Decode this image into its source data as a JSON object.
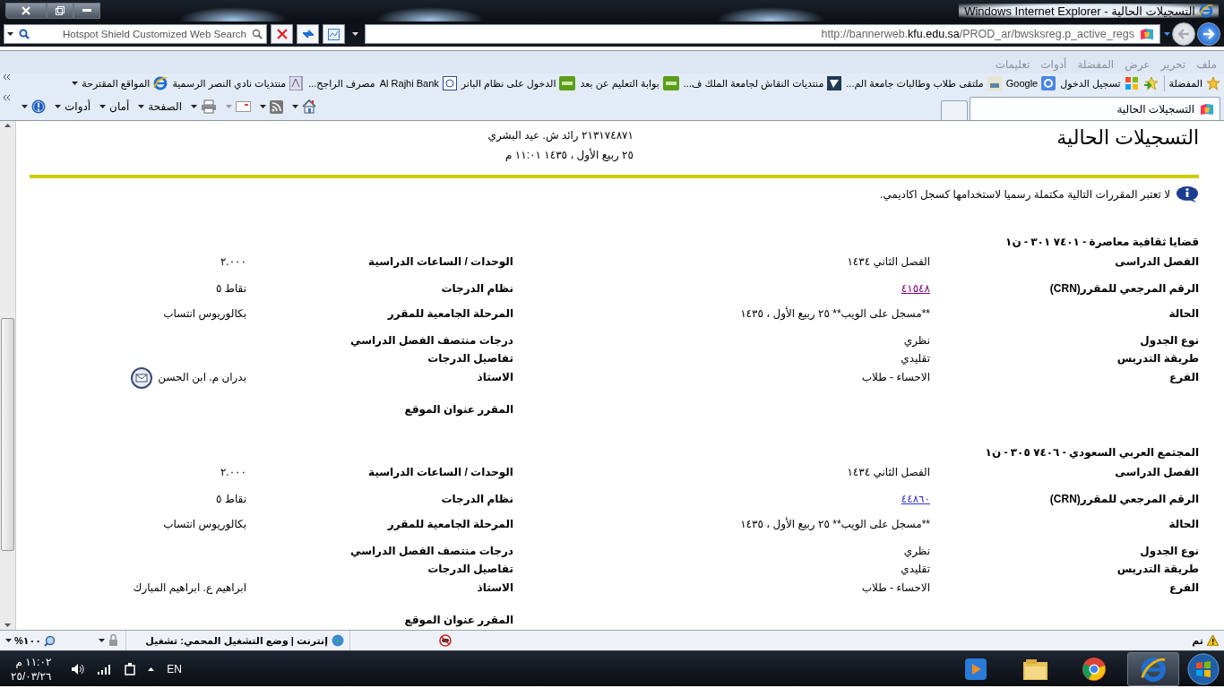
{
  "window": {
    "title": "التسجيلات الحالية - Windows Internet Explorer"
  },
  "address_bar": {
    "url": "http://bannerweb.**kfu.edu.sa**/PROD_ar/bwsksreg.p_active_regs"
  },
  "search": {
    "placeholder": "Hotspot Shield Customized Web Search"
  },
  "menu": [
    "ملف",
    "تحرير",
    "عرض",
    "المفضلة",
    "أدوات",
    "تعليمات"
  ],
  "favorites_bar": {
    "label": "المفضلة",
    "items": [
      {
        "label": "تسجيل الدخول"
      },
      {
        "label": "Google"
      },
      {
        "label": "ملتقى طلاب وطالبات جامعة الم..."
      },
      {
        "label": "منتديات النقاش لجامعة الملك ف..."
      },
      {
        "label": "بوابة التعليم عن بعد"
      },
      {
        "label": "الدخول على نظام البانر"
      },
      {
        "label": "Al Rajhi Bank"
      },
      {
        "label": "مصرف الراجح..."
      },
      {
        "label": "منتديات نادي النصر الرسمية"
      },
      {
        "label": "المواقع المقترحة"
      }
    ]
  },
  "tabs": [
    {
      "label": "التسجيلات الحالية",
      "selected": true
    }
  ],
  "command_bar": {
    "menus": [
      "الصفحة",
      "أمان",
      "أدوات"
    ]
  },
  "page": {
    "title": "التسجيلات الحالية",
    "student": "٢١٣١٧٤٨٧١ رائد ش. عيد البشري",
    "datetime": "٢٥ ربيع الأول ، ١٤٣٥ ١١:٠١ م",
    "note": "لا تعتبر المقررات التالية مكتملة رسميا لاستخدامها كسجل اكاديمي."
  },
  "courses": [
    {
      "heading": "قضايا ثقافية معاصرة - ٧٤٠١ ٣٠١ - ن١",
      "email_link": true,
      "right": [
        {
          "label": "الفصل الدراسى",
          "value": "الفصل الثاني ١٤٣٤"
        },
        {
          "label": "الرقم المرجعي للمقرر(CRN)",
          "value": "٤١٥٤٨",
          "kind": "link",
          "visited": true
        },
        {
          "label": "الحالة",
          "value": "**مسجل على الويب** ٢٥ ربيع الأول ، ١٤٣٥"
        },
        {
          "label": "نوع الجدول",
          "value": "نظري"
        },
        {
          "label": "طريقة التدريس",
          "value": "تقليدي"
        },
        {
          "label": "الفرع",
          "value": "الاحساء - طلاب"
        }
      ],
      "left": [
        {
          "label": "الوحدات / الساعات الدراسية",
          "value": "٢.٠٠٠"
        },
        {
          "label": "نظام الدرجات",
          "value": "نقاط ٥"
        },
        {
          "label": "المرحلة الجامعية للمقرر",
          "value": "بكالوريوس انتساب"
        },
        {
          "label": "درجات منتصف الفصل الدراسي"
        },
        {
          "label": "تفاصيل الدرجات"
        },
        {
          "label": "الاستاذ",
          "value": "بدران م. ابن الحسن",
          "kind": "instructor"
        },
        {
          "label": "المقرر عنوان الموقع"
        }
      ]
    },
    {
      "heading": "المجتمع العربي السعودي - ٧٤٠٦ ٣٠٥ - ن١",
      "email_link": false,
      "right": [
        {
          "label": "الفصل الدراسى",
          "value": "الفصل الثاني ١٤٣٤"
        },
        {
          "label": "الرقم المرجعي للمقرر(CRN)",
          "value": "٤٤٨٦٠",
          "kind": "link",
          "visited": false
        },
        {
          "label": "الحالة",
          "value": "**مسجل على الويب** ٢٥ ربيع الأول ، ١٤٣٥"
        },
        {
          "label": "نوع الجدول",
          "value": "نظري"
        },
        {
          "label": "طريقة التدريس",
          "value": "تقليدي"
        },
        {
          "label": "الفرع",
          "value": "الاحساء - طلاب"
        }
      ],
      "left": [
        {
          "label": "الوحدات / الساعات الدراسية",
          "value": "٢.٠٠٠"
        },
        {
          "label": "نظام الدرجات",
          "value": "نقاط ٥"
        },
        {
          "label": "المرحلة الجامعية للمقرر",
          "value": "بكالوريوس انتساب"
        },
        {
          "label": "درجات منتصف الفصل الدراسي"
        },
        {
          "label": "تفاصيل الدرجات"
        },
        {
          "label": "الاستاذ",
          "value": "ابراهيم ع. ابراهيم المبارك",
          "kind": "instructor"
        },
        {
          "label": "المقرر عنوان الموقع"
        }
      ]
    }
  ],
  "status_bar": {
    "status": "تم",
    "zone": "إنترنت | وضع التشغيل المحمي: تشغيل",
    "zoom": "١٠٠%"
  },
  "taskbar": {
    "language": "EN",
    "time": "١١:٠٢ م",
    "date": "٢٥/٠٣/٢٦",
    "apps": [
      {
        "selected": true
      },
      {
        "selected": false
      },
      {
        "selected": false
      },
      {
        "selected": false
      }
    ]
  }
}
